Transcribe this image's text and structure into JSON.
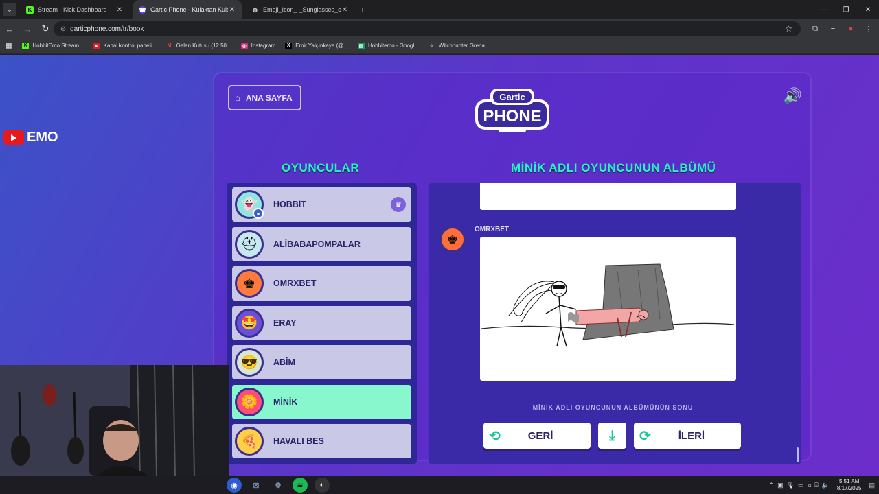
{
  "browser": {
    "tabs": [
      {
        "title": "Stream - Kick Dashboard",
        "icon": "kick-icon",
        "active": false
      },
      {
        "title": "Gartic Phone - Kulaktan Kulağa",
        "icon": "gartic-icon",
        "active": true
      },
      {
        "title": "Emoji_Icon_-_Sunglasses_cool_e",
        "icon": "globe-icon",
        "active": false
      }
    ],
    "url": "garticphone.com/tr/book",
    "bookmarks": [
      {
        "label": "HobbitEmo Stream...",
        "icon": "kick-icon",
        "color": "#53fc18"
      },
      {
        "label": "Kanal kontrol paneli...",
        "icon": "youtube-icon",
        "color": "#e8191d"
      },
      {
        "label": "Gelen Kutusu (12.50...",
        "icon": "gmail-icon",
        "color": "#ea4335"
      },
      {
        "label": "Instagram",
        "icon": "instagram-icon",
        "color": "#d62976"
      },
      {
        "label": "Emir Yalçınkaya (@...",
        "icon": "x-icon",
        "color": "#000000"
      },
      {
        "label": "Hobbitemo - Googl...",
        "icon": "sheets-icon",
        "color": "#0f9d58"
      },
      {
        "label": "Witchhunter Grena...",
        "icon": "witch-icon",
        "color": "#8a6fd0"
      }
    ]
  },
  "overlay": {
    "channel": "EMO"
  },
  "game": {
    "home_label": "ANA SAYFA",
    "logo_top": "Gartic",
    "logo_bottom": "PHONE",
    "players_heading": "OYUNCULAR",
    "album_heading": "MİNİK ADLI OYUNCUNUN ALBÜMÜ",
    "players": [
      {
        "name": "HOBBİT",
        "avatar": "ghost-avatar",
        "color": "#8fe6e0",
        "selected": false,
        "host": true
      },
      {
        "name": "ALİBABAPOMPALAR",
        "avatar": "knight-avatar",
        "color": "#c7e8f0",
        "selected": false,
        "host": false
      },
      {
        "name": "OMRXBET",
        "avatar": "king-avatar",
        "color": "#ff7a3d",
        "selected": false,
        "host": false
      },
      {
        "name": "ERAY",
        "avatar": "star-eyes-avatar",
        "color": "#6b4fd8",
        "selected": false,
        "host": false
      },
      {
        "name": "ABİM",
        "avatar": "sunglasses-avatar",
        "color": "#d8e8d0",
        "selected": false,
        "host": false
      },
      {
        "name": "MİNİK",
        "avatar": "flower-avatar",
        "color": "#ff4d7a",
        "selected": true,
        "host": false
      },
      {
        "name": "HAVALI BES",
        "avatar": "pizza-avatar",
        "color": "#ffcf4a",
        "selected": false,
        "host": false
      }
    ],
    "album": {
      "author": "OMRXBET",
      "end_text": "MİNİK ADLI OYUNCUNUN ALBÜMÜNÜN SONU",
      "back_label": "GERİ",
      "next_label": "İLERİ"
    }
  },
  "taskbar": {
    "time": "5:51 AM",
    "date": "8/17/2025"
  }
}
